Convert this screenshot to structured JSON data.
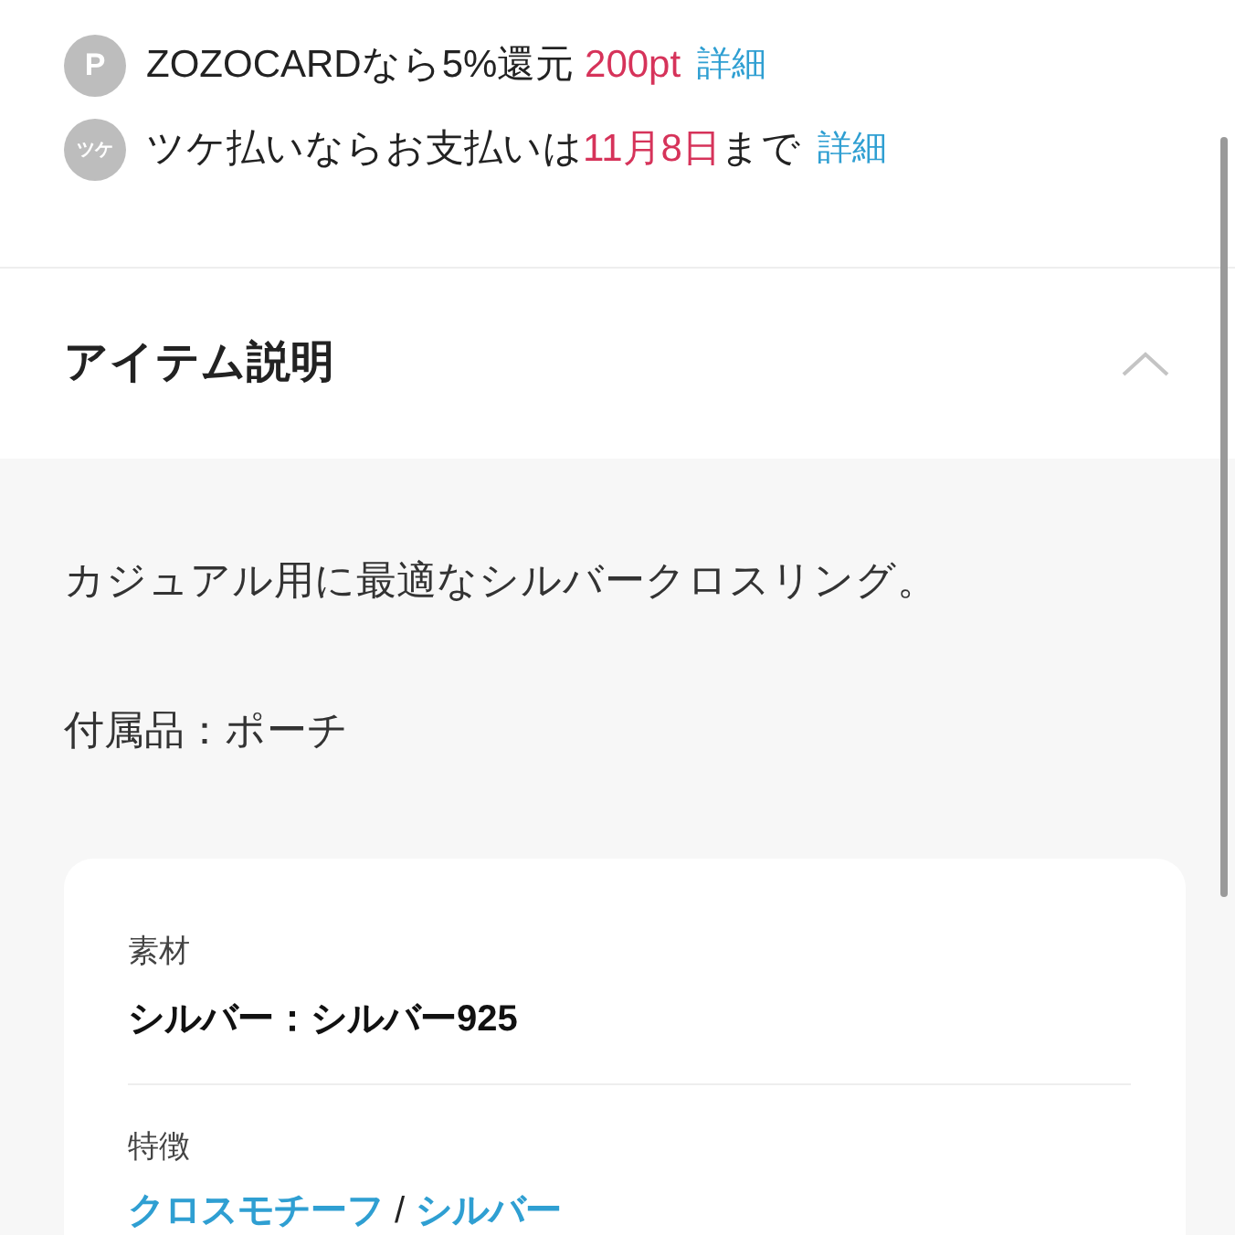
{
  "benefits": [
    {
      "badge": "P",
      "segments": [
        {
          "kind": "plain",
          "text": "ZOZOCARDなら5%還元 "
        },
        {
          "kind": "highlight",
          "text": "200pt"
        }
      ],
      "link": "詳細"
    },
    {
      "badge": "ツケ",
      "segments": [
        {
          "kind": "plain",
          "text": "ツケ払いならお支払いは"
        },
        {
          "kind": "highlight",
          "text": "11月8日"
        },
        {
          "kind": "plain",
          "text": "まで"
        }
      ],
      "link": "詳細"
    }
  ],
  "item_description": {
    "title": "アイテム説明",
    "expanded": true,
    "paragraphs": [
      "カジュアル用に最適なシルバークロスリング。",
      "付属品：ポーチ"
    ],
    "specs": [
      {
        "kind": "text",
        "label": "素材",
        "value": "シルバー：シルバー925"
      },
      {
        "kind": "links",
        "label": "特徴",
        "links": [
          "クロスモチーフ",
          "シルバー"
        ],
        "separator": "/"
      }
    ]
  }
}
